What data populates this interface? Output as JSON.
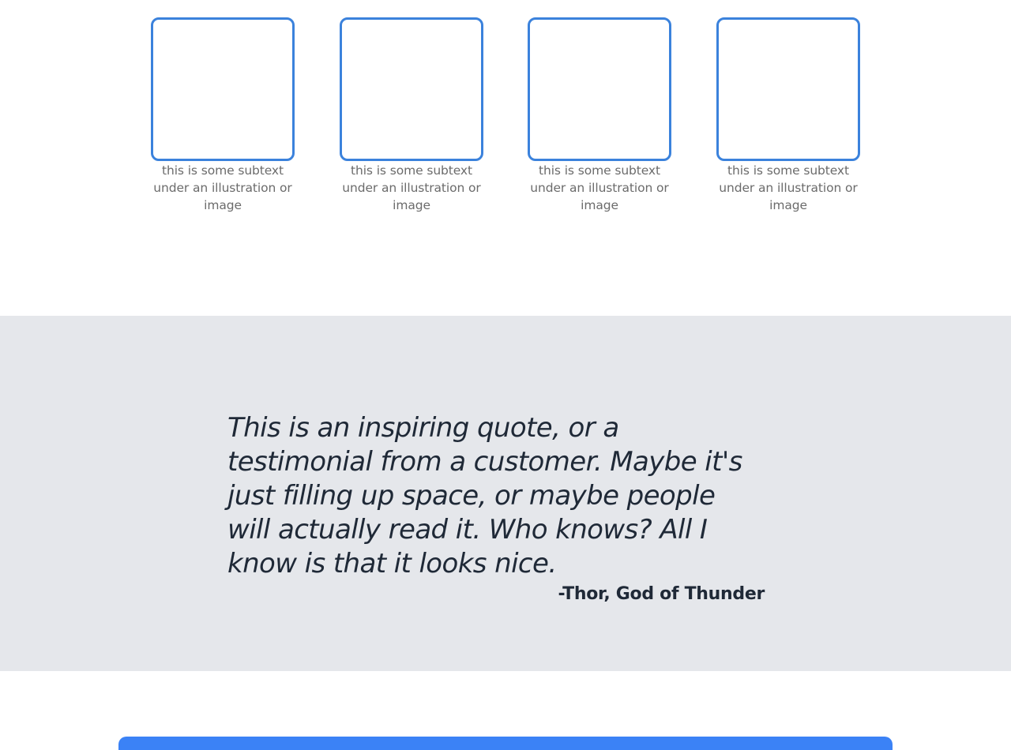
{
  "info_cards": [
    {
      "caption": "this is some subtext under an illustration or image"
    },
    {
      "caption": "this is some subtext under an illustration or image"
    },
    {
      "caption": "this is some subtext under an illustration or image"
    },
    {
      "caption": "this is some subtext under an illustration or image"
    }
  ],
  "quote": {
    "text": "This is an inspiring quote, or a testimonial from a customer. Maybe it's just filling up space, or maybe people will actually read it. Who knows? All I know is that it looks nice.",
    "author": "-Thor, God of Thunder"
  },
  "colors": {
    "accent": "#3b82dc",
    "quote_background": "#e5e7eb",
    "cta_background": "#3b82f6",
    "caption_text": "#6b6b6b",
    "quote_text": "#1f2937"
  }
}
